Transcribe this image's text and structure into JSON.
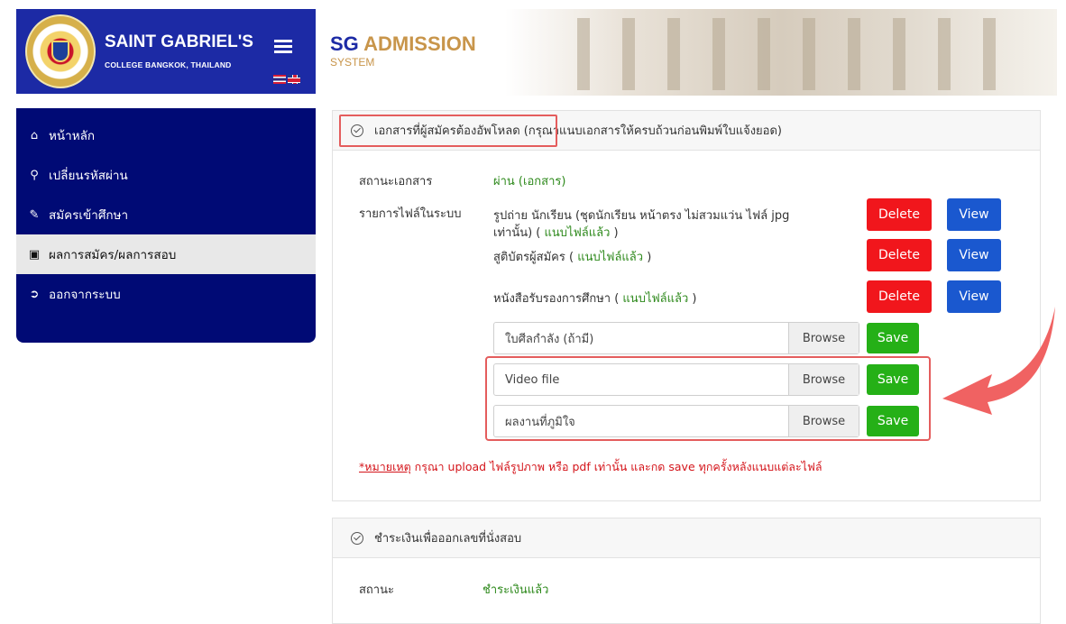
{
  "brand": {
    "title": "SAINT GABRIEL'S",
    "subtitle": "COLLEGE BANGKOK, THAILAND"
  },
  "header": {
    "title_main": "SG ",
    "title_accent": "ADMISSION",
    "subtitle": "SYSTEM"
  },
  "sidebar": {
    "items": [
      {
        "label": "หน้าหลัก",
        "icon": "home-icon"
      },
      {
        "label": "เปลี่ยนรหัสผ่าน",
        "icon": "key-icon"
      },
      {
        "label": "สมัครเข้าศึกษา",
        "icon": "edit-icon"
      },
      {
        "label": "ผลการสมัคร/ผลการสอบ",
        "icon": "doc-icon",
        "active": true
      },
      {
        "label": "ออกจากระบบ",
        "icon": "sign-out-icon"
      }
    ]
  },
  "documents": {
    "title": "เอกสารที่ผู้สมัครต้องอัพโหลด (กรุณาแนบเอกสารให้ครบถ้วนก่อนพิมพ์ใบแจ้งยอด)",
    "status_label": "สถานะเอกสาร",
    "status_value": "ผ่าน (เอกสาร)",
    "files_label": "รายการไฟล์ในระบบ",
    "files": [
      {
        "name_line1": "รูปถ่าย นักเรียน (ชุดนักเรียน หน้าตรง ไม่สวมแว่น ไฟล์ jpg",
        "name_line2": "เท่านั้น) (",
        "attached": "แนบไฟล์แล้ว",
        "close": " )"
      },
      {
        "name_line1": "สูติบัตรผู้สมัคร (",
        "attached": "แนบไฟล์แล้ว",
        "close": " )"
      },
      {
        "name_line1": "หนังสือรับรองการศึกษา (",
        "attached": "แนบไฟล์แล้ว",
        "close": " )"
      }
    ],
    "delete_label": "Delete",
    "view_label": "View",
    "uploads": [
      {
        "placeholder": "ใบศีลกำลัง (ถ้ามี)"
      },
      {
        "placeholder": "Video file"
      },
      {
        "placeholder": "ผลงานที่ภูมิใจ"
      }
    ],
    "browse_label": "Browse",
    "save_label": "Save",
    "note_prefix": "*หมายเหตุ",
    "note_text": " กรุณา upload ไฟล์รูปภาพ หรือ pdf เท่านั้น และกด save ทุกครั้งหลังแนบแต่ละไฟล์"
  },
  "payment": {
    "title": "ชำระเงินเพื่อออกเลขที่นั่งสอบ",
    "status_label": "สถานะ",
    "status_value": "ชำระเงินแล้ว"
  },
  "colors": {
    "sidebar_top": "#1c2aa5",
    "sidebar_nav": "#000a75",
    "delete": "#f1161c",
    "view": "#1a58cf",
    "save": "#25b017",
    "success_text": "#2f8a1d",
    "highlight": "#e45d5d"
  }
}
